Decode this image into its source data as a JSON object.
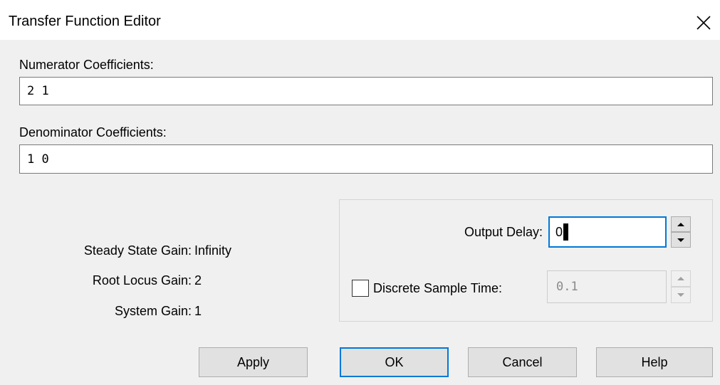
{
  "window": {
    "title": "Transfer Function Editor"
  },
  "numerator": {
    "label": "Numerator Coefficients:",
    "value": "2 1"
  },
  "denominator": {
    "label": "Denominator Coefficients:",
    "value": "1 0"
  },
  "gains": [
    {
      "label": "Steady State Gain:",
      "value": "Infinity"
    },
    {
      "label": "Root Locus Gain:",
      "value": "2"
    },
    {
      "label": "System Gain:",
      "value": "1"
    }
  ],
  "output_delay": {
    "label": "Output Delay:",
    "value": "0"
  },
  "discrete_sample_time": {
    "label": "Discrete Sample Time:",
    "checked": false,
    "value": "0.1"
  },
  "buttons": {
    "apply": "Apply",
    "ok": "OK",
    "cancel": "Cancel",
    "help": "Help"
  },
  "colors": {
    "client_background": "#f0f0f0",
    "focus_accent": "#0078d7",
    "button_face": "#e1e1e1"
  },
  "icons": {
    "close": "close-icon",
    "spin_up": "chevron-up-icon",
    "spin_down": "chevron-down-icon"
  }
}
